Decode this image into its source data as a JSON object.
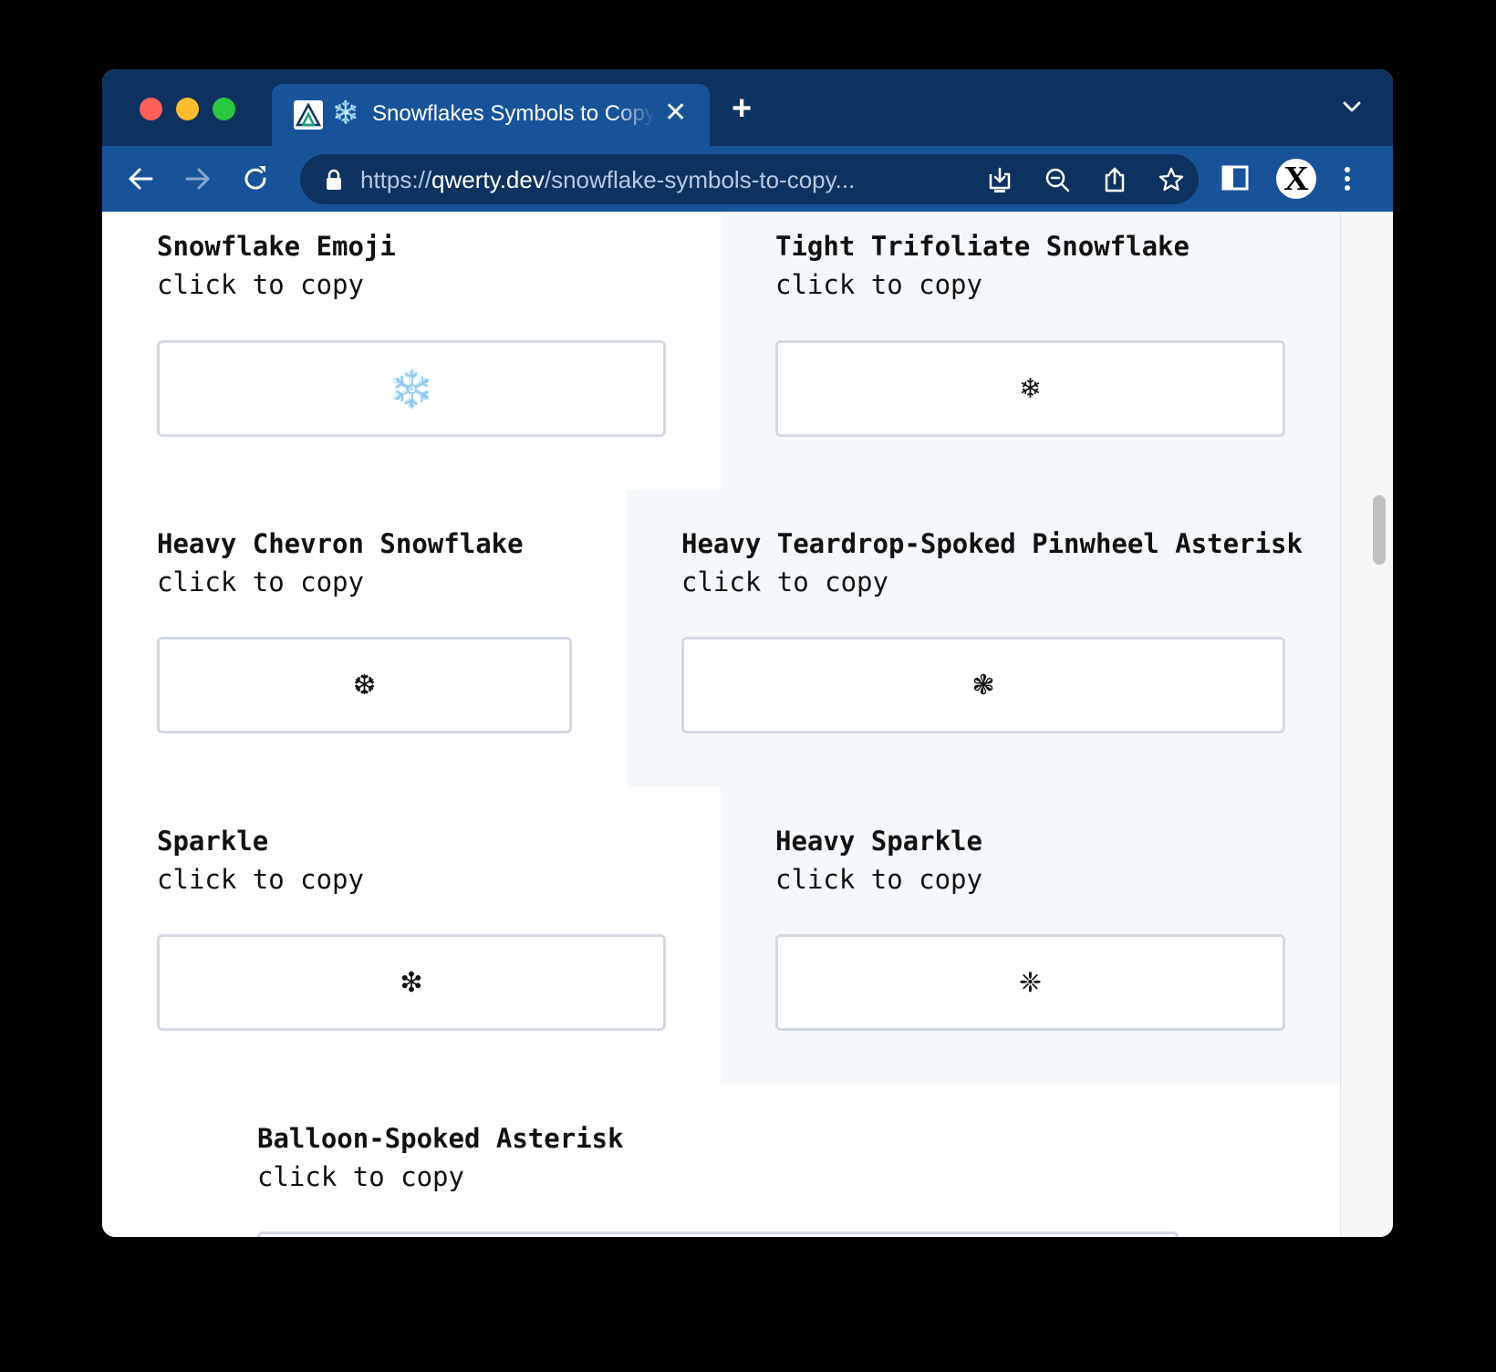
{
  "browser": {
    "tab": {
      "snow_icon": "❄️",
      "title": "Snowflakes Symbols to Copy",
      "close": "✕"
    },
    "new_tab": "+",
    "url": {
      "scheme": "https://",
      "host": "qwerty.dev",
      "path": "/snowflake-symbols-to-copy..."
    },
    "profile_initial": "X"
  },
  "cards": [
    {
      "title": "Snowflake Emoji",
      "action": "click to copy",
      "symbol": "❄️"
    },
    {
      "title": "Tight Trifoliate Snowflake",
      "action": "click to copy",
      "symbol": "❄"
    },
    {
      "title": "Heavy Chevron Snowflake",
      "action": "click to copy",
      "symbol": "❆"
    },
    {
      "title": "Heavy Teardrop-Spoked Pinwheel Asterisk",
      "action": "click to copy",
      "symbol": "❃"
    },
    {
      "title": "Sparkle",
      "action": "click to copy",
      "symbol": "❇"
    },
    {
      "title": "Heavy Sparkle",
      "action": "click to copy",
      "symbol": "❈"
    },
    {
      "title": "Balloon-Spoked Asterisk",
      "action": "click to copy",
      "symbol": ""
    }
  ],
  "colors": {
    "tab_strip": "#0e3260",
    "toolbar": "#18539a",
    "card_border": "#d3d9e3",
    "shaded_bg": "#f5f8fb"
  }
}
